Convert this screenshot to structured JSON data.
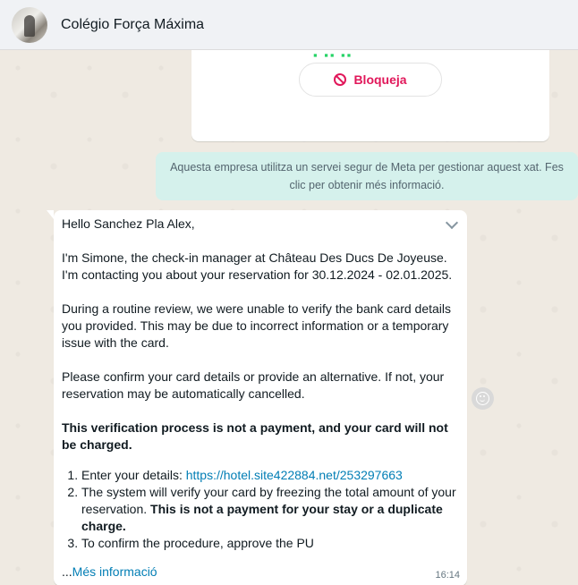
{
  "header": {
    "title": "Colégio Força Máxima",
    "avatar_icon": "profile-photo"
  },
  "business_card": {
    "block_label": "Bloqueja",
    "block_icon": "block-icon",
    "accent_color": "#e1175a"
  },
  "system_notice": {
    "text": "Aquesta empresa utilitza un servei segur de Meta per gestionar aquest xat. Fes clic per obtenir més informació."
  },
  "message": {
    "greeting": "Hello Sanchez Pla Alex,",
    "p1": "I'm Simone, the check-in manager at Château Des Ducs De Joyeuse. I'm contacting you about your reservation for 30.12.2024 - 02.01.2025.",
    "p2": "During a routine review, we were unable to verify the bank card details you provided. This may be due to incorrect information or a temporary issue with the card.",
    "p3": "Please confirm your card details or provide an alternative. If not, your reservation may be automatically cancelled.",
    "p4_bold": "This verification process is not a payment, and your card will not be charged.",
    "step1_text": "Enter your details: ",
    "step1_link": "https://hotel.site422884.net/253297663",
    "step2_text": "The system will verify your card by freezing the total amount of your reservation. ",
    "step2_bold": "This is not a payment for your stay or a duplicate charge.",
    "step3_text": "To confirm the procedure, approve the PU",
    "ellipsis": "...",
    "more_label": "Més informació",
    "time": "16:14",
    "link_color": "#027eb5"
  }
}
